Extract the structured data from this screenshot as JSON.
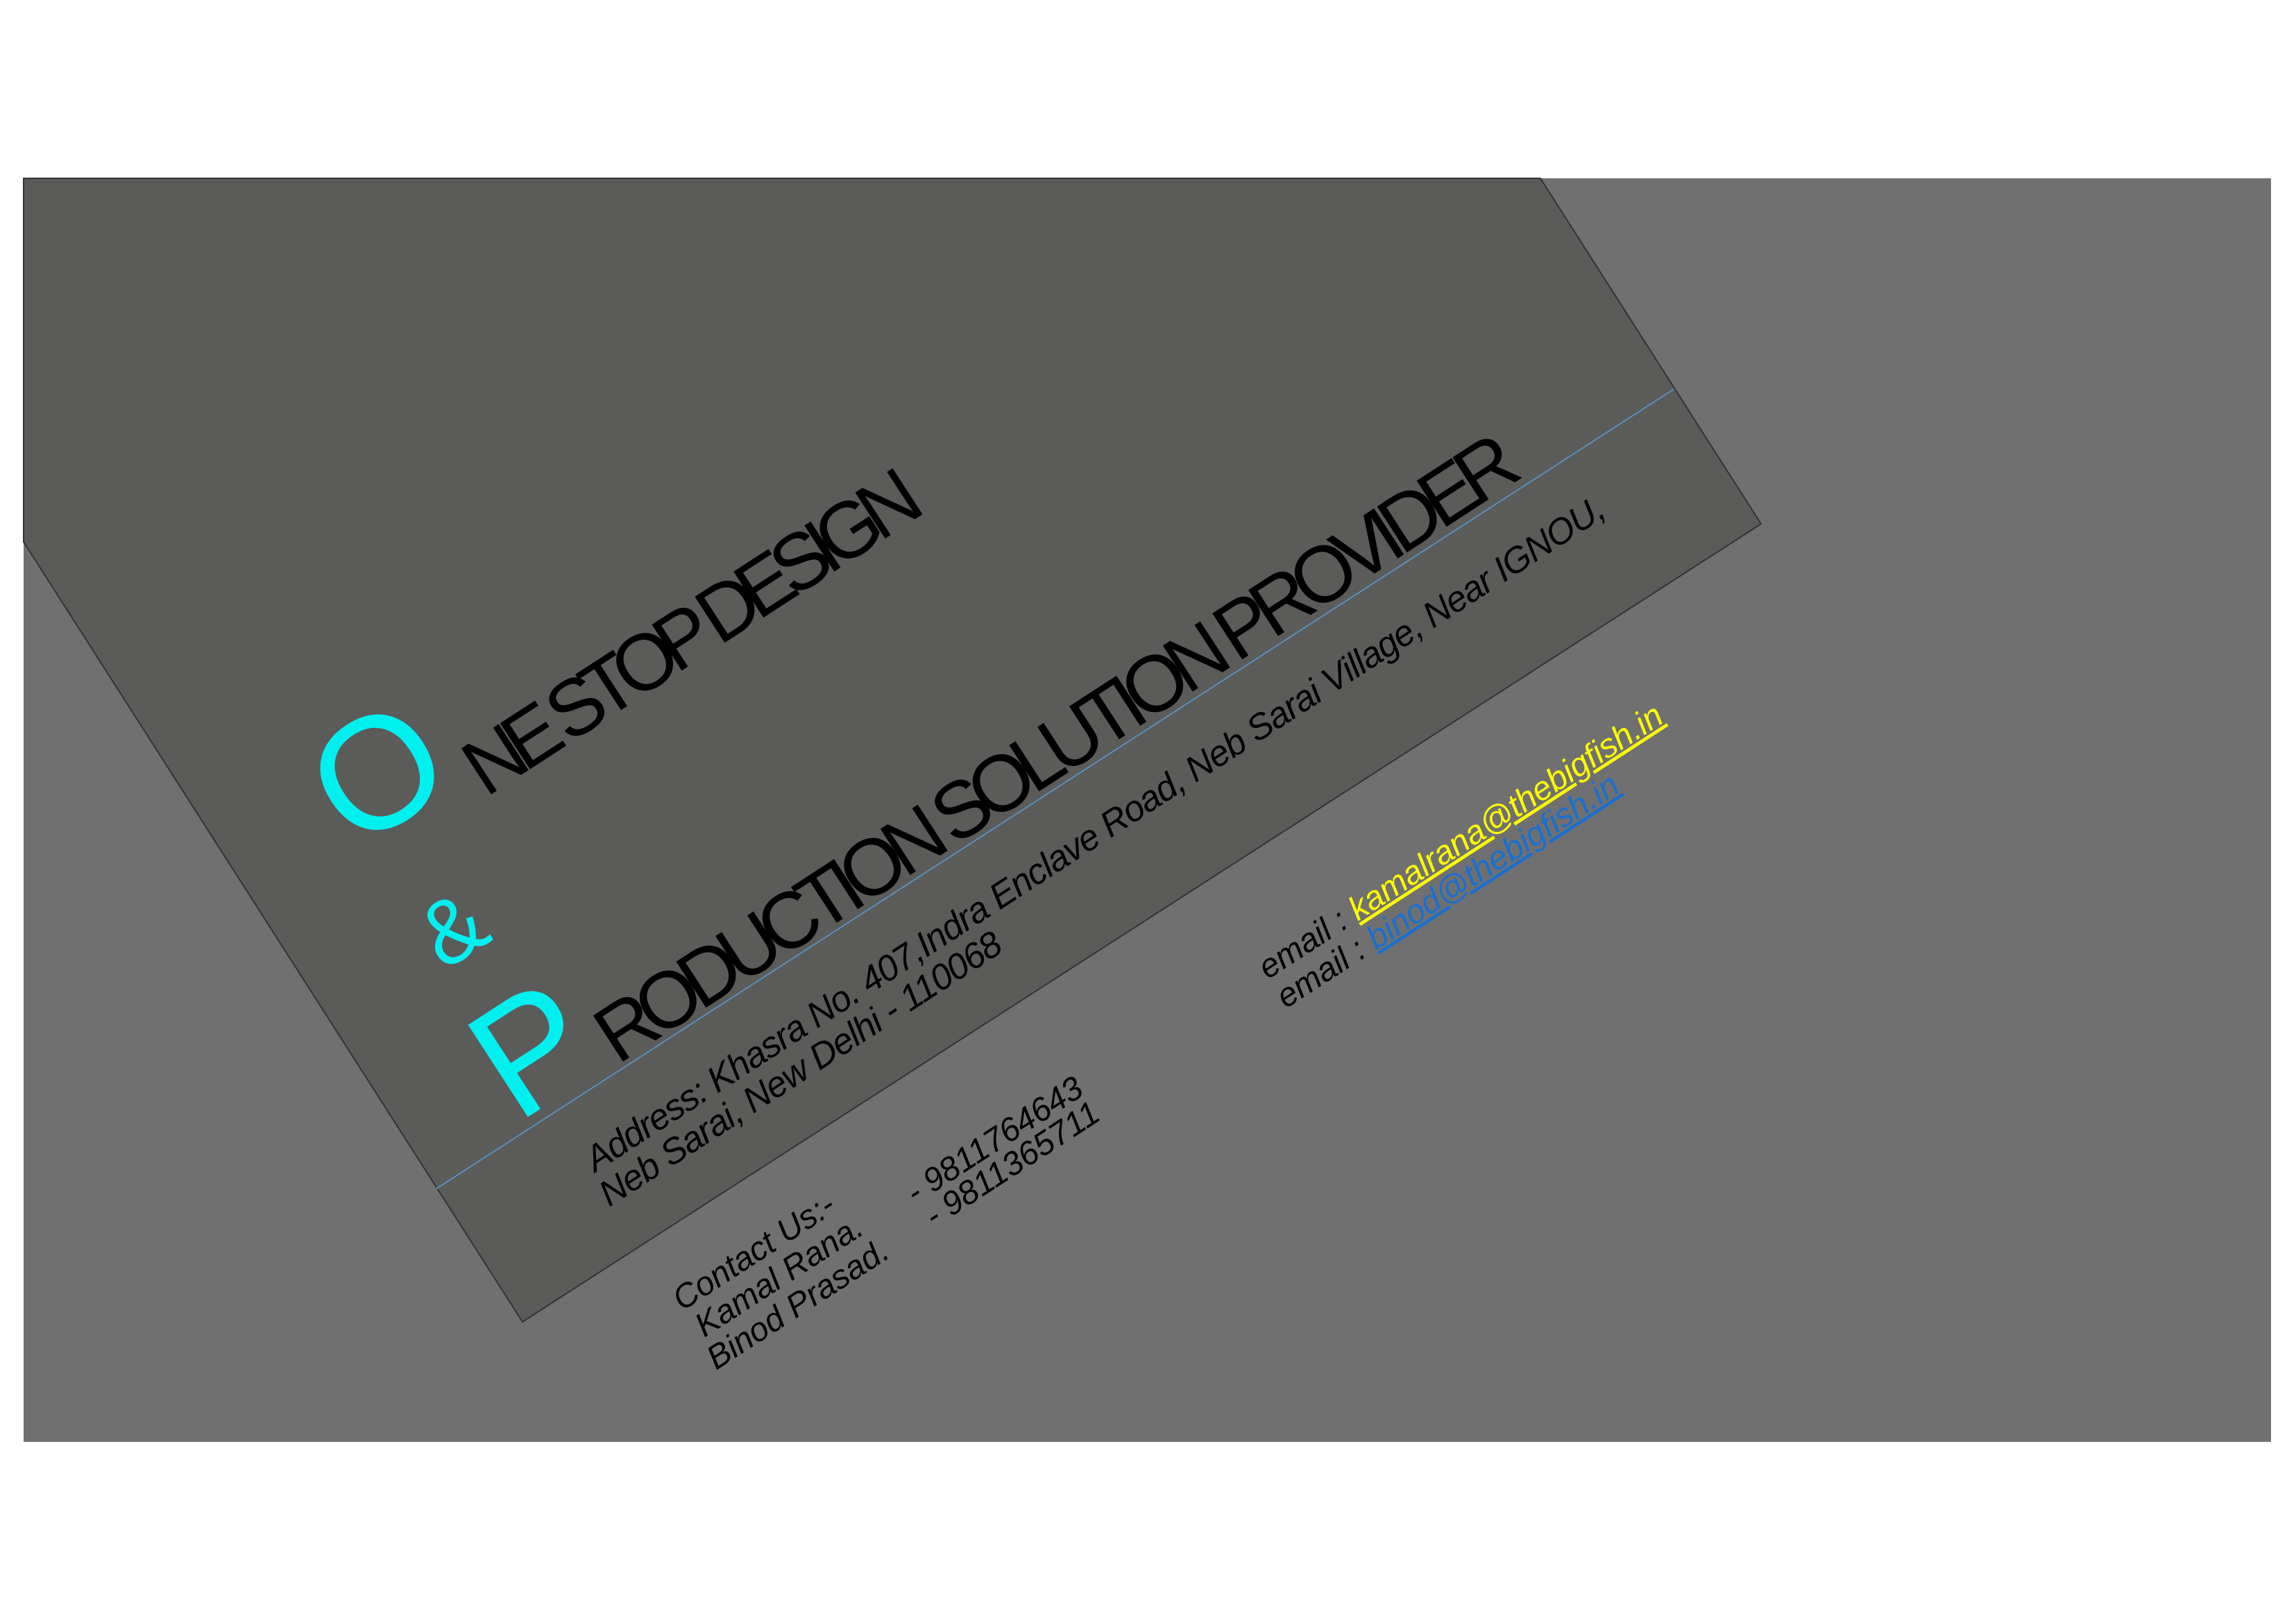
{
  "colors": {
    "background": "#ffffff",
    "panel": "#707070",
    "card": "#5b5b59",
    "accent": "#00f0f0",
    "divider": "#5a8fc0",
    "email1": "#ffff00",
    "email2": "#1a6fd0",
    "text": "#000000"
  },
  "title": {
    "initial_o": "O",
    "line1_rest": "NE STOP DESIGN",
    "ampersand": "&",
    "initial_p": "P",
    "line2_rest": "RODUCTION SOLUTION PROVIDER"
  },
  "address": {
    "line1": "Address: Khasra No. 407,Indra Enclave Road, Neb Sarai Village, Near IGNOU,",
    "line2": "Neb Sarai, New Delhi - 110068"
  },
  "contact": {
    "heading": "Contact Us:-",
    "people": [
      {
        "name": "Kamal Rana.",
        "phone": "- 9811764643"
      },
      {
        "name": "Binod Prasad.",
        "phone": "- 9811365711"
      }
    ]
  },
  "emails": [
    {
      "label": "email : ",
      "address": "kamalrana@thebigfish.in"
    },
    {
      "label": "email : ",
      "address": "binod@thebigfish.in"
    }
  ]
}
